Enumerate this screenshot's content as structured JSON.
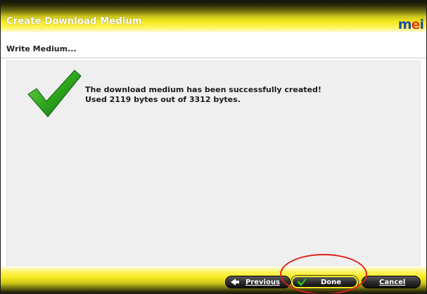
{
  "window": {
    "title": "Create Download Medium",
    "logo": {
      "m": "m",
      "e": "e",
      "i": "i"
    }
  },
  "step": {
    "label": "Write Medium..."
  },
  "message": {
    "line1": "The download medium has been successfully created!",
    "line2": "Used 2119 bytes out of 3312 bytes."
  },
  "footer": {
    "previous_label": "Previous",
    "done_label": "Done",
    "cancel_label": "Cancel"
  },
  "icons": {
    "success": "checkmark-icon",
    "previous": "back-arrow-icon",
    "done": "checkmark-icon"
  },
  "colors": {
    "accent_yellow": "#f4ea1e",
    "check_green": "#2a9a1a",
    "highlight_red": "#e0201b"
  }
}
